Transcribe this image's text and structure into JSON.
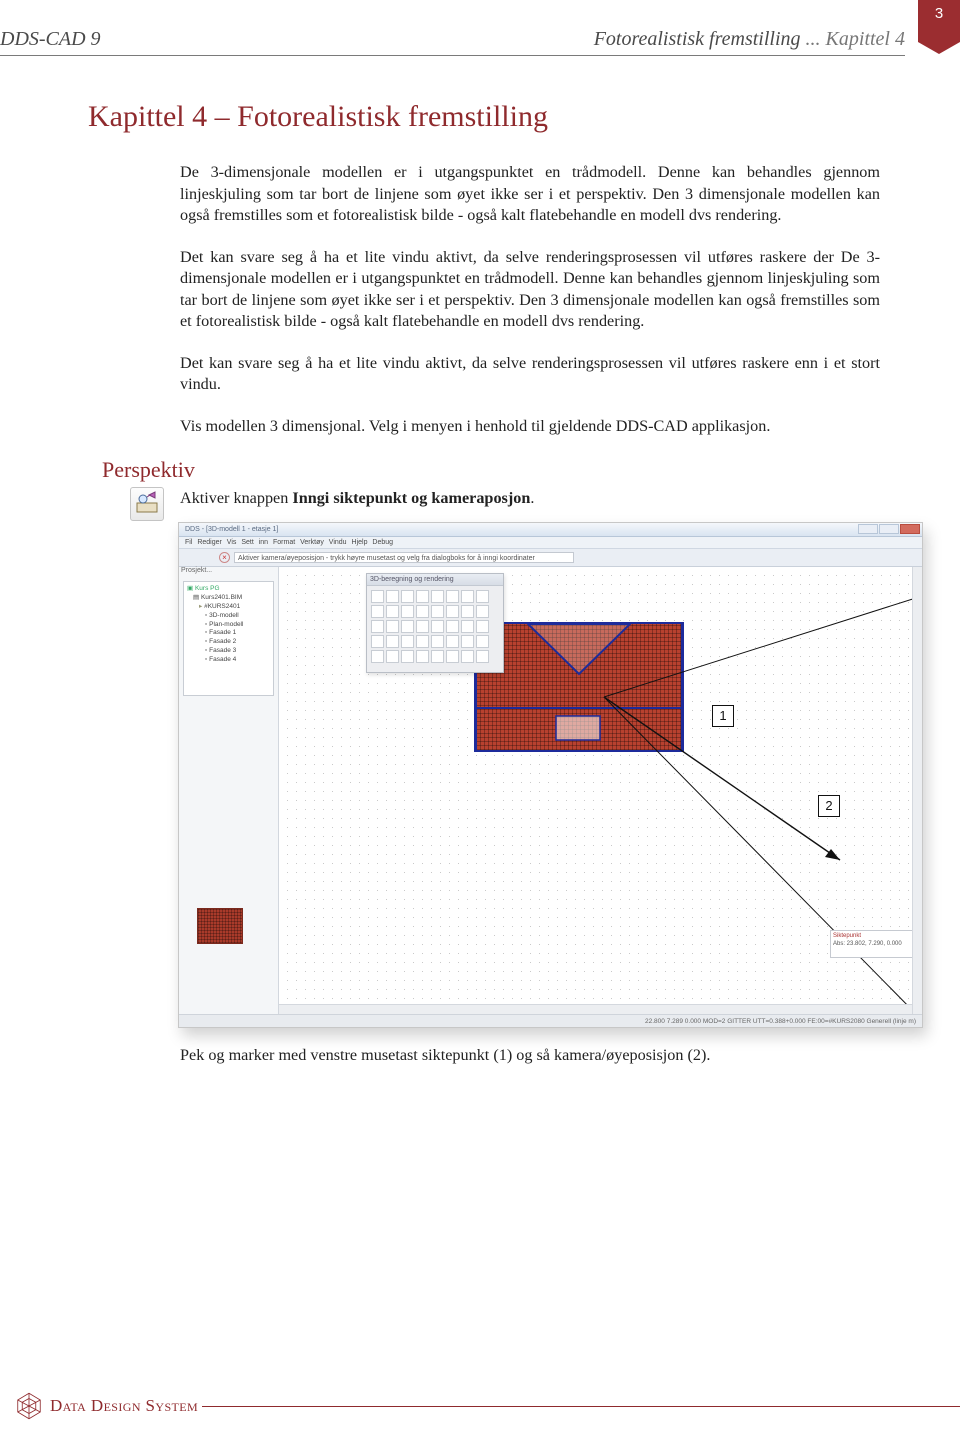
{
  "page_number": "3",
  "header_left": "DDS-CAD 9",
  "header_right_main": "Fotorealistisk fremstilling",
  "header_right_suffix": "... Kapittel 4",
  "chapter_title": "Kapittel 4 – Fotorealistisk fremstilling",
  "para1": "De 3-dimensjonale modellen er i utgangspunktet en trådmodell. Denne kan behandles gjennom linjeskjuling som tar bort de linjene som øyet ikke ser i et perspektiv. Den 3 dimensjonale modellen kan også fremstilles som et fotorealistisk bilde - også kalt flatebehandle en modell dvs rendering.",
  "para2": "Det kan svare seg å ha et lite vindu aktivt, da selve renderingsprosessen vil utføres raskere der De 3-dimensjonale modellen er i utgangspunktet en trådmodell. Denne kan behandles gjennom linjeskjuling som tar bort de linjene som øyet ikke ser i et perspektiv. Den 3 dimensjonale modellen kan også fremstilles som et fotorealistisk bilde - også kalt flatebehandle en modell dvs rendering.",
  "para3": "Det kan svare seg å ha et lite vindu aktivt, da selve renderingsprosessen vil utføres raskere enn i et stort vindu.",
  "para4": "Vis modellen 3 dimensjonal.  Velg i menyen i henhold til gjeldende DDS-CAD applikasjon.",
  "subheading": "Perspektiv",
  "activate_pre": "Aktiver knappen ",
  "activate_bold": "Inngi siktepunkt og kameraposjon",
  "activate_post": ".",
  "marker1": "1",
  "marker2": "2",
  "caption": "Pek og marker med venstre musetast siktepunkt (1) og så kamera/øyeposisjon (2).",
  "brand": "Data Design System",
  "app": {
    "title": "DDS -  [3D-modell 1 - etasje 1]",
    "menu": "Fil   Rediger   Vis   Sett inn   Format   Verktøy   Vindu   Hjelp   Debug",
    "message": "Aktiver kamera/øyeposisjon - trykk høyre musetast og velg fra dialogboks for å inngi koordinater",
    "tree_root": "Kurs PG",
    "tree_proj": "Kurs2401.BIM",
    "tree_items": [
      "#KURS2401",
      "3D-modell",
      "Plan-modell",
      "Fasade 1",
      "Fasade 2",
      "Fasade 3",
      "Fasade 4"
    ],
    "palette_title": "3D-beregning og rendering",
    "info_title": "Siktepunkt",
    "info_coords": "Abs: 23.802, 7.290, 0.000",
    "status": "22.800      7.289      0.000        MOD=2 GITTER   UTT=0.388+0.000     FE:00=#KURS2080    Generell (linje  m)"
  }
}
